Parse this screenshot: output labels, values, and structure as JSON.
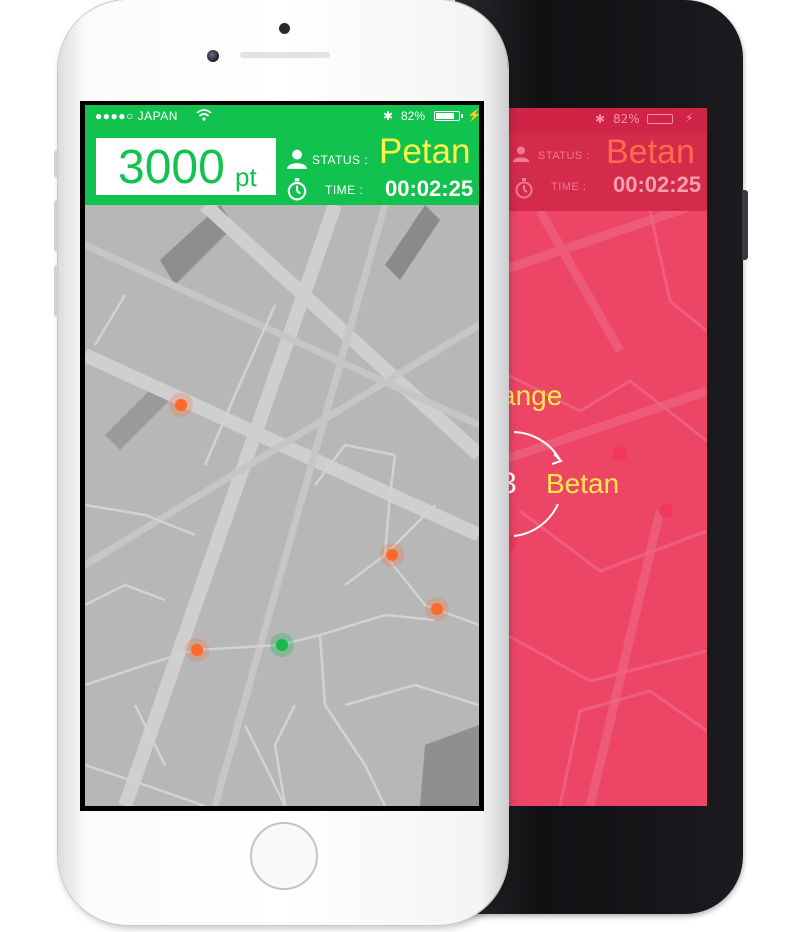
{
  "front_phone": {
    "status_bar": {
      "carrier": "●●●●○ JAPAN",
      "battery_percent": "82%",
      "battery_level": 0.82
    },
    "score": {
      "value": "3000",
      "unit": "pt"
    },
    "status": {
      "label": "STATUS :",
      "value": "Petan"
    },
    "time": {
      "label": "TIME  :",
      "value": "00:02:25"
    },
    "map": {
      "player_color": "#19b84a",
      "enemy_color": "#ff6a2a"
    },
    "colors": {
      "accent": "#12c24f",
      "status_value": "#fff44a"
    }
  },
  "back_phone": {
    "status_bar": {
      "battery_percent": "82%"
    },
    "status": {
      "label": "STATUS :",
      "value": "Betan"
    },
    "time": {
      "label": "TIME  :",
      "value": "00:02:25"
    },
    "change_text": "ange",
    "countdown": "3",
    "next_status": "Betan",
    "colors": {
      "background": "#ec4565",
      "header": "#d42b4b",
      "status_value": "#ff6a4f",
      "highlight": "#ffe94a"
    }
  }
}
